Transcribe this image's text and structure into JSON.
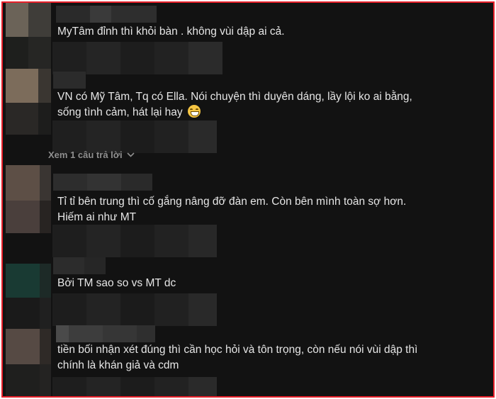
{
  "colors": {
    "frame_border": "#e8202a",
    "background": "#121212",
    "text": "#e6e6e6",
    "muted": "#8f8f8f"
  },
  "comments": [
    {
      "text": "MyTâm đỉnh thì khỏi bàn . không vùi dập ai cả."
    },
    {
      "text": "VN có Mỹ Tâm, Tq có Ella. Nói chuyện thì duyên dáng, lầy lội ko ai bằng,",
      "text2": "sống tình cảm, hát lại hay",
      "emoji": "grin-emoji"
    },
    {
      "text": "Tỉ tỉ bên trung thì cố gắng nâng đỡ đàn em. Còn bên mình toàn sợ hơn.",
      "text2": "Hiếm ai như MT"
    },
    {
      "text": "Bởi TM sao so vs MT dc"
    },
    {
      "text": "tiền bối nhận xét đúng thì cần học hỏi và tôn trọng, còn nếu nói vùi dập thì",
      "text2": "chính là khán giả và cdm"
    }
  ],
  "replies": {
    "label": "Xem 1 câu trả lời",
    "icon": "chevron-down-icon"
  }
}
